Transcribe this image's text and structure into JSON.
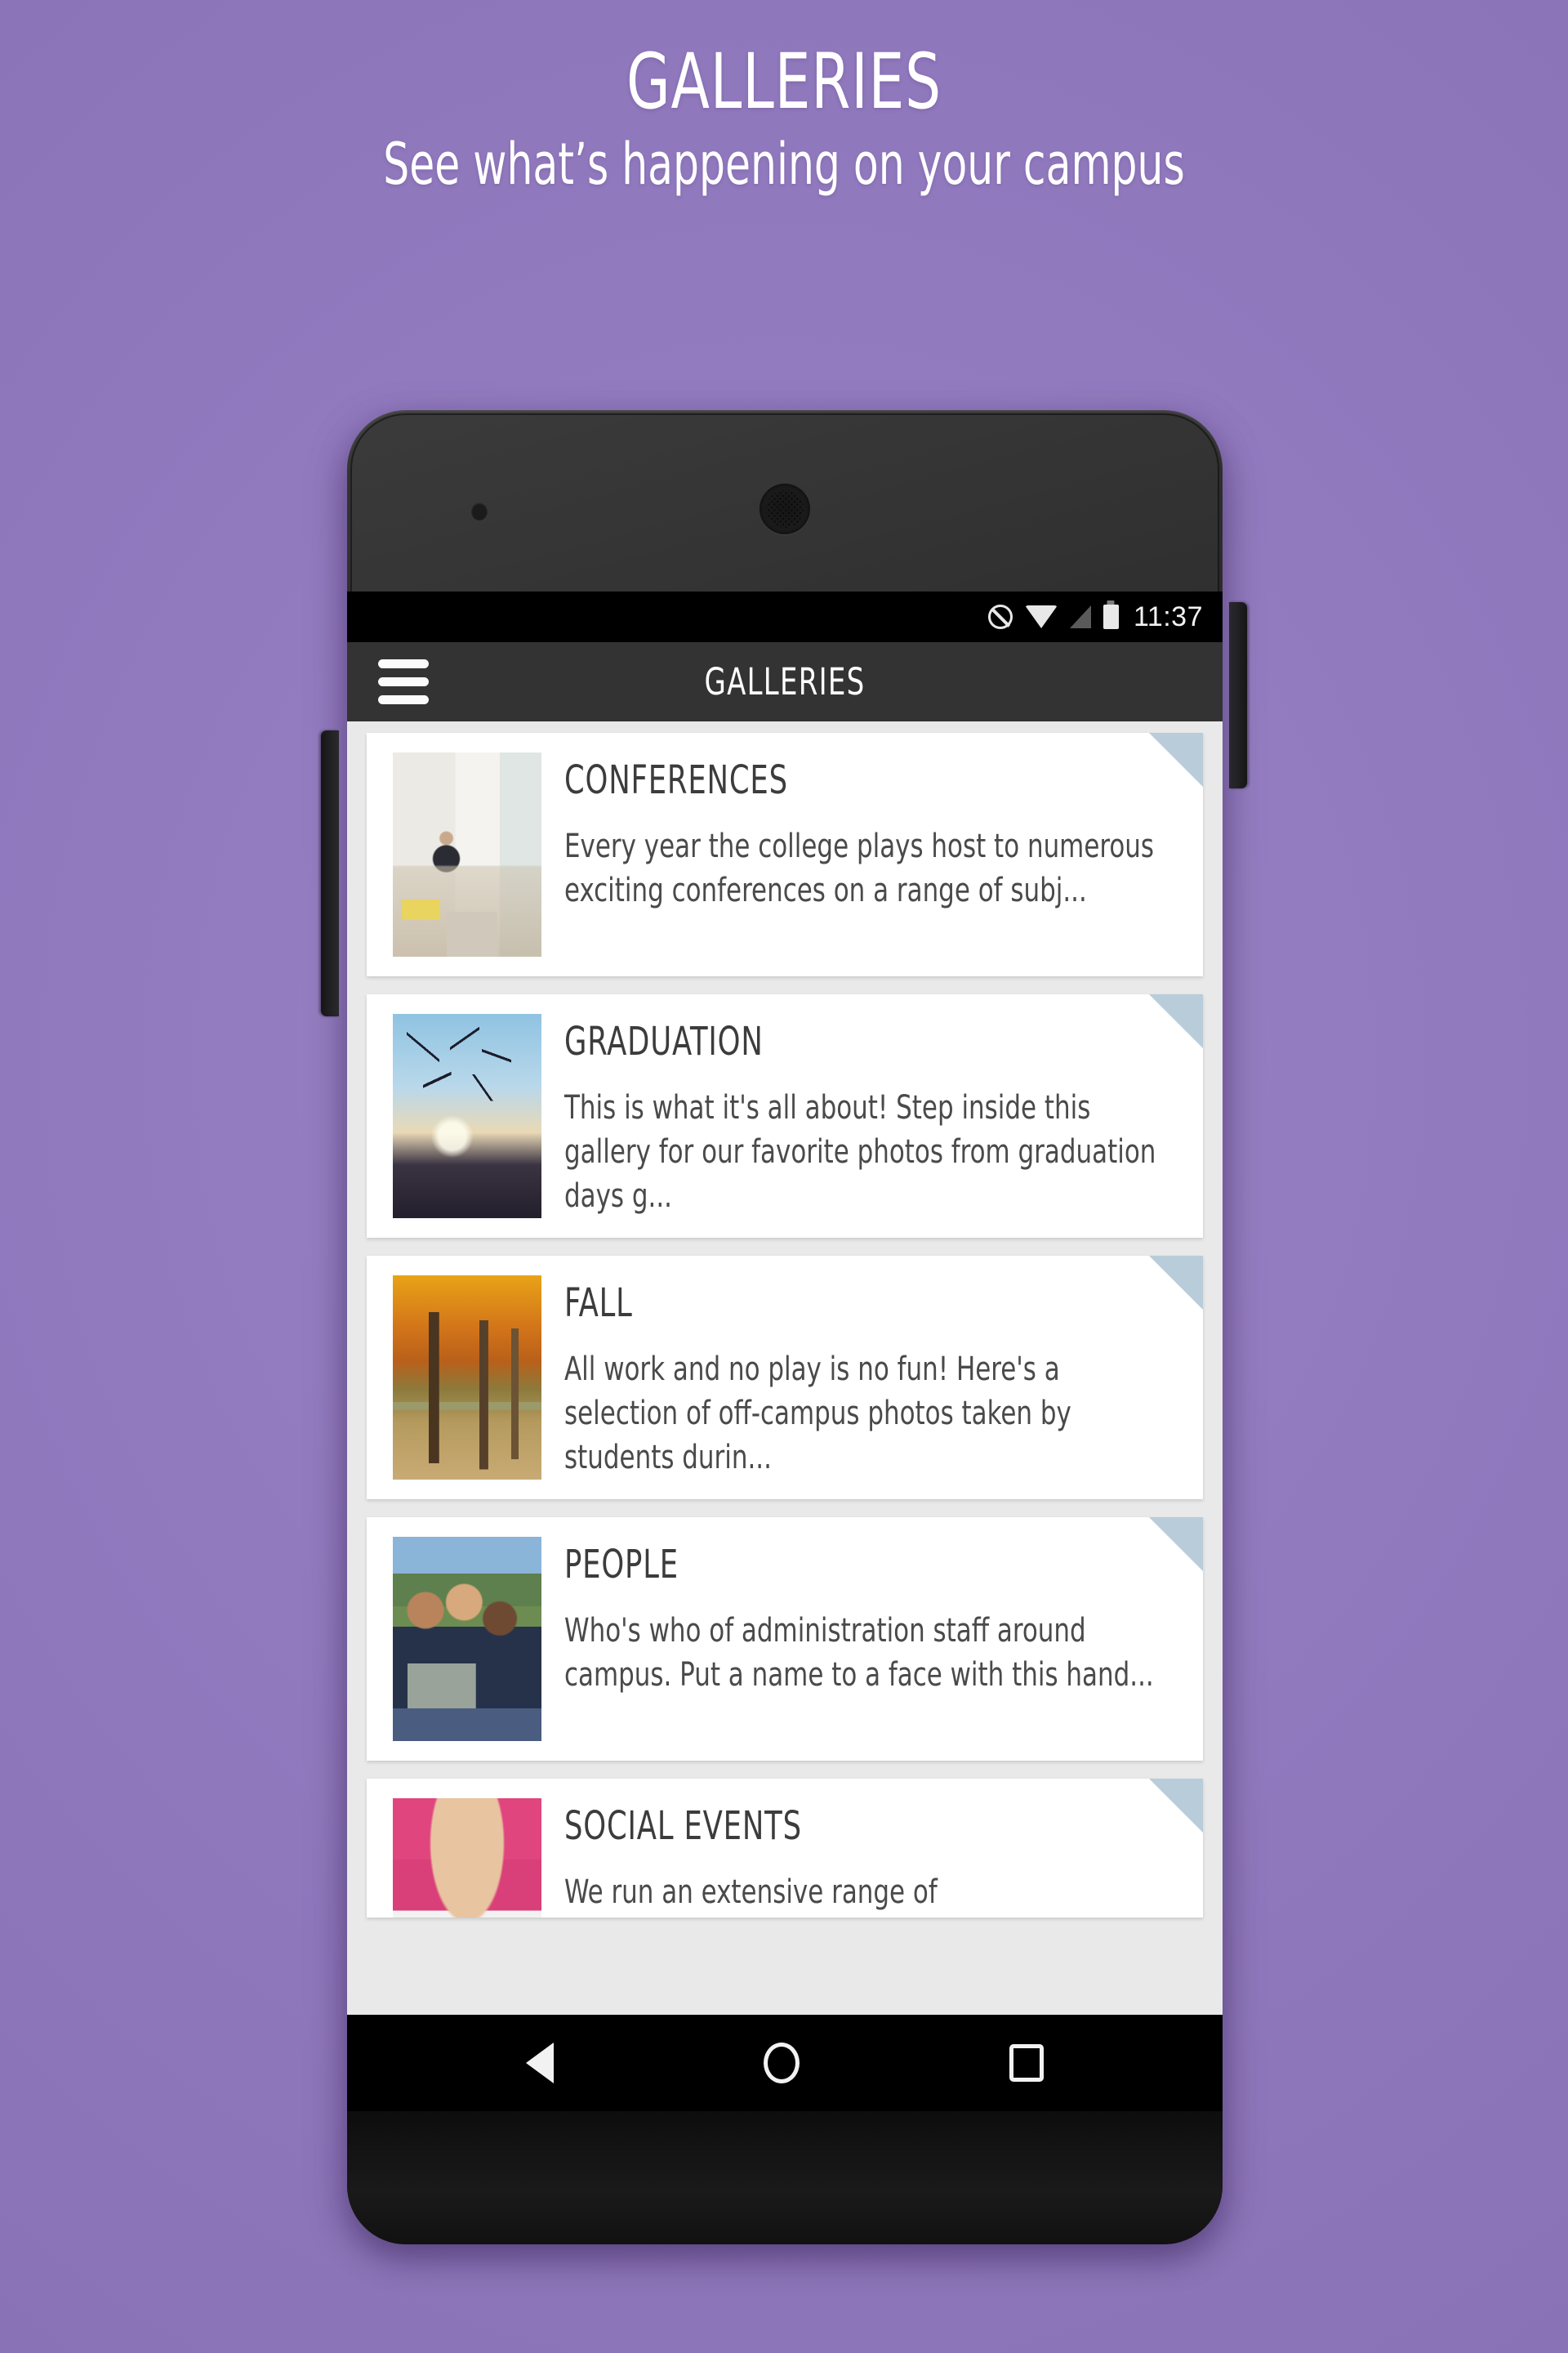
{
  "promo": {
    "title": "GALLERIES",
    "subtitle": "See what’s happening on your campus"
  },
  "device": {
    "status_bar": {
      "icons": [
        "do-not-disturb-icon",
        "wifi-icon",
        "signal-icon",
        "battery-icon"
      ],
      "time": "11:37"
    },
    "nav_bar": {
      "back_label": "back-icon",
      "home_label": "home-icon",
      "recents_label": "recents-icon"
    },
    "hardware": {
      "camera": "front-camera",
      "speaker": "earpiece-speaker",
      "volume_button": "volume-rocker",
      "power_button": "power-button"
    }
  },
  "app": {
    "appbar": {
      "menu_icon": "hamburger-menu-icon",
      "title": "GALLERIES"
    },
    "galleries": [
      {
        "title": "CONFERENCES",
        "description": "Every year the college plays host to numerous exciting conferences on a range of subj...",
        "thumb": "conferences-photo"
      },
      {
        "title": "GRADUATION",
        "description": "This is what it's all about!  Step inside this gallery for our favorite photos from graduation days g...",
        "thumb": "graduation-photo"
      },
      {
        "title": "FALL",
        "description": "All work and no play is no fun! Here's a selection of off-campus photos taken by students durin...",
        "thumb": "fall-photo"
      },
      {
        "title": "PEOPLE",
        "description": "Who's who of administration staff around campus.  Put a name to a face with this hand...",
        "thumb": "people-photo"
      },
      {
        "title": "SOCIAL EVENTS",
        "description": "We run an extensive range of",
        "thumb": "social-events-photo"
      }
    ]
  },
  "colors": {
    "background_purple": "#9078bd",
    "appbar_dark": "#333333",
    "card_white": "#ffffff",
    "list_grey": "#e9e9e9",
    "corner_blue": "#b9ccda",
    "title_text": "#3c3c3c",
    "body_text": "#4a4a4a"
  }
}
